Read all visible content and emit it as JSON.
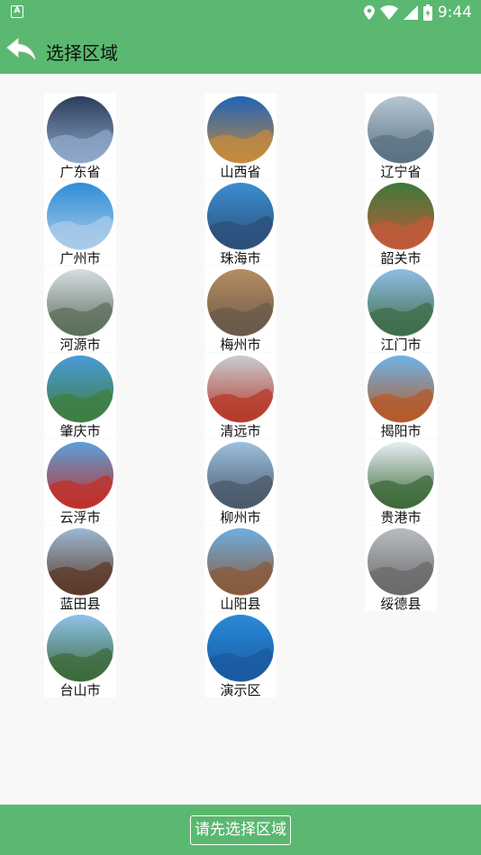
{
  "status_bar": {
    "time": "9:44",
    "notification_icon": "A"
  },
  "header": {
    "title": "选择区域",
    "back_icon": "back-arrow-icon"
  },
  "regions": [
    {
      "label": "广东省",
      "icon": "circle-photo",
      "colors": [
        "#2b3c5a",
        "#8fa8c9"
      ]
    },
    {
      "label": "山西省",
      "icon": "circle-photo",
      "colors": [
        "#1f63b8",
        "#c58a3e"
      ]
    },
    {
      "label": "辽宁省",
      "icon": "circle-photo",
      "colors": [
        "#b7c7d4",
        "#5a7182"
      ]
    },
    {
      "label": "广州市",
      "icon": "circle-photo",
      "colors": [
        "#2e8ed8",
        "#a9cbe9"
      ]
    },
    {
      "label": "珠海市",
      "icon": "circle-photo",
      "colors": [
        "#3b8ed0",
        "#2c4f7a"
      ]
    },
    {
      "label": "韶关市",
      "icon": "circle-photo",
      "colors": [
        "#3d7a3a",
        "#c25a3a"
      ]
    },
    {
      "label": "河源市",
      "icon": "circle-photo",
      "colors": [
        "#d7dde3",
        "#5c6f5c"
      ]
    },
    {
      "label": "梅州市",
      "icon": "circle-photo",
      "colors": [
        "#b78d60",
        "#6a5a4a"
      ]
    },
    {
      "label": "江门市",
      "icon": "circle-photo",
      "colors": [
        "#8fbde3",
        "#3e6e4a"
      ]
    },
    {
      "label": "肇庆市",
      "icon": "circle-photo",
      "colors": [
        "#4a9bd8",
        "#3f7d3f"
      ]
    },
    {
      "label": "清远市",
      "icon": "circle-photo",
      "colors": [
        "#c8ccd2",
        "#b53a2a"
      ]
    },
    {
      "label": "揭阳市",
      "icon": "circle-photo",
      "colors": [
        "#6fb3e6",
        "#b55a2a"
      ]
    },
    {
      "label": "云浮市",
      "icon": "circle-photo",
      "colors": [
        "#5aa0dc",
        "#c0302a"
      ]
    },
    {
      "label": "柳州市",
      "icon": "circle-photo",
      "colors": [
        "#9dc0e0",
        "#4a5a6a"
      ]
    },
    {
      "label": "贵港市",
      "icon": "circle-photo",
      "colors": [
        "#e8eef2",
        "#3d6a3a"
      ]
    },
    {
      "label": "蓝田县",
      "icon": "circle-photo",
      "colors": [
        "#9cb8d2",
        "#5c3a2a"
      ]
    },
    {
      "label": "山阳县",
      "icon": "circle-photo",
      "colors": [
        "#6eaee0",
        "#8a5a3a"
      ]
    },
    {
      "label": "绥德县",
      "icon": "circle-photo",
      "colors": [
        "#b8bcc2",
        "#6a6a6a"
      ]
    },
    {
      "label": "台山市",
      "icon": "circle-photo",
      "colors": [
        "#8ec2ea",
        "#3d6a3a"
      ]
    },
    {
      "label": "演示区",
      "icon": "circle-photo",
      "colors": [
        "#2a8ad8",
        "#1a5aa0"
      ]
    }
  ],
  "footer": {
    "confirm_label": "请先选择区域"
  },
  "theme": {
    "primary": "#5bb870",
    "background": "#f8f8f8"
  }
}
